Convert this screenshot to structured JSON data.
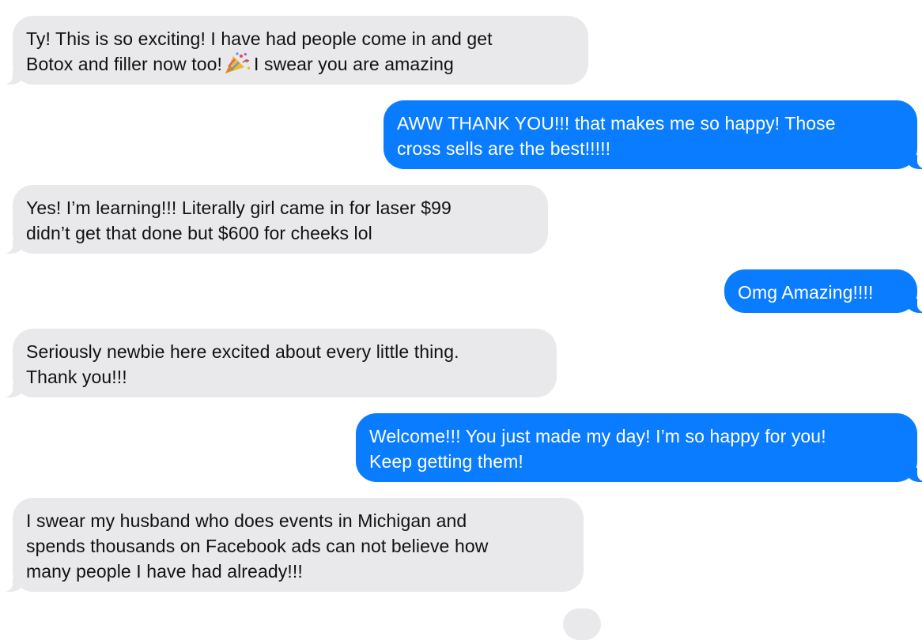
{
  "thread": {
    "messages": [
      {
        "direction": "incoming",
        "lines": [
          "Ty! This is so exciting! I have had people come in and get",
          "Botox and filler now too!",
          "I swear you are amazing"
        ],
        "emoji": "party-popper-icon"
      },
      {
        "direction": "outgoing",
        "lines": [
          "AWW THANK YOU!!! that makes me so happy! Those",
          "cross sells are the best!!!!!"
        ]
      },
      {
        "direction": "incoming",
        "lines": [
          "Yes! I’m learning!!! Literally girl came in for laser $99",
          "didn’t get that done but $600 for cheeks lol"
        ]
      },
      {
        "direction": "outgoing",
        "lines": [
          "Omg Amazing!!!!"
        ]
      },
      {
        "direction": "incoming",
        "lines": [
          "Seriously newbie here excited about every little thing.",
          "Thank you!!!"
        ]
      },
      {
        "direction": "outgoing",
        "lines": [
          "Welcome!!! You just made my day! I’m so happy for you!",
          "Keep getting them!"
        ]
      },
      {
        "direction": "incoming",
        "lines": [
          "I swear my husband who does events in Michigan and",
          "spends thousands on Facebook ads can not believe how",
          "many people I have had already!!!"
        ]
      }
    ]
  },
  "colors": {
    "incoming_bubble": "#e9e9eb",
    "outgoing_bubble": "#0a7cff",
    "incoming_text": "#111111",
    "outgoing_text": "#ffffff"
  }
}
